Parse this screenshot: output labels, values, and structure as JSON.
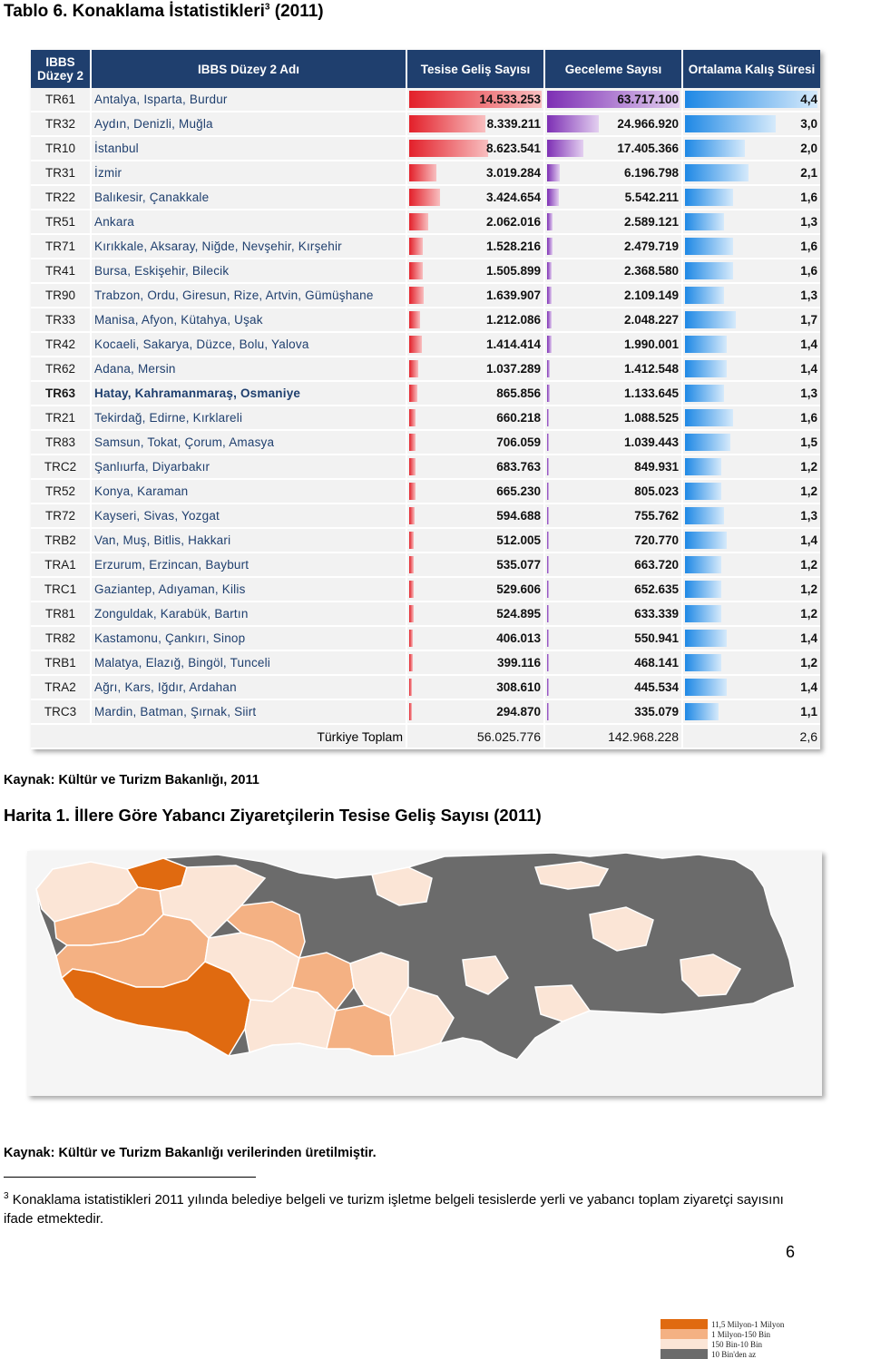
{
  "title": {
    "text": "Tablo 6. Konaklama İstatistikleri",
    "sup": "3",
    "tail": " (2011)"
  },
  "table": {
    "headers": [
      "IBBS Düzey 2",
      "IBBS Düzey 2 Adı",
      "Tesise Geliş Sayısı",
      "Geceleme Sayısı",
      "Ortalama Kalış Süresi"
    ],
    "rows": [
      {
        "code": "TR61",
        "name": "Antalya, Isparta, Burdur",
        "arrivals": "14.533.253",
        "nights": "63.717.100",
        "stay": "4,4",
        "a": 14533253,
        "n": 63717100,
        "s": 4.4
      },
      {
        "code": "TR32",
        "name": "Aydın, Denizli, Muğla",
        "arrivals": "8.339.211",
        "nights": "24.966.920",
        "stay": "3,0",
        "a": 8339211,
        "n": 24966920,
        "s": 3.0
      },
      {
        "code": "TR10",
        "name": "İstanbul",
        "arrivals": "8.623.541",
        "nights": "17.405.366",
        "stay": "2,0",
        "a": 8623541,
        "n": 17405366,
        "s": 2.0
      },
      {
        "code": "TR31",
        "name": "İzmir",
        "arrivals": "3.019.284",
        "nights": "6.196.798",
        "stay": "2,1",
        "a": 3019284,
        "n": 6196798,
        "s": 2.1
      },
      {
        "code": "TR22",
        "name": "Balıkesir, Çanakkale",
        "arrivals": "3.424.654",
        "nights": "5.542.211",
        "stay": "1,6",
        "a": 3424654,
        "n": 5542211,
        "s": 1.6
      },
      {
        "code": "TR51",
        "name": "Ankara",
        "arrivals": "2.062.016",
        "nights": "2.589.121",
        "stay": "1,3",
        "a": 2062016,
        "n": 2589121,
        "s": 1.3
      },
      {
        "code": "TR71",
        "name": "Kırıkkale, Aksaray, Niğde, Nevşehir, Kırşehir",
        "arrivals": "1.528.216",
        "nights": "2.479.719",
        "stay": "1,6",
        "a": 1528216,
        "n": 2479719,
        "s": 1.6
      },
      {
        "code": "TR41",
        "name": "Bursa, Eskişehir, Bilecik",
        "arrivals": "1.505.899",
        "nights": "2.368.580",
        "stay": "1,6",
        "a": 1505899,
        "n": 2368580,
        "s": 1.6
      },
      {
        "code": "TR90",
        "name": "Trabzon, Ordu, Giresun, Rize, Artvin, Gümüşhane",
        "arrivals": "1.639.907",
        "nights": "2.109.149",
        "stay": "1,3",
        "a": 1639907,
        "n": 2109149,
        "s": 1.3
      },
      {
        "code": "TR33",
        "name": "Manisa, Afyon, Kütahya, Uşak",
        "arrivals": "1.212.086",
        "nights": "2.048.227",
        "stay": "1,7",
        "a": 1212086,
        "n": 2048227,
        "s": 1.7
      },
      {
        "code": "TR42",
        "name": "Kocaeli, Sakarya, Düzce, Bolu, Yalova",
        "arrivals": "1.414.414",
        "nights": "1.990.001",
        "stay": "1,4",
        "a": 1414414,
        "n": 1990001,
        "s": 1.4
      },
      {
        "code": "TR62",
        "name": "Adana, Mersin",
        "arrivals": "1.037.289",
        "nights": "1.412.548",
        "stay": "1,4",
        "a": 1037289,
        "n": 1412548,
        "s": 1.4
      },
      {
        "code": "TR63",
        "name": "Hatay, Kahramanmaraş, Osmaniye",
        "arrivals": "865.856",
        "nights": "1.133.645",
        "stay": "1,3",
        "a": 865856,
        "n": 1133645,
        "s": 1.3,
        "bold": true
      },
      {
        "code": "TR21",
        "name": "Tekirdağ, Edirne, Kırklareli",
        "arrivals": "660.218",
        "nights": "1.088.525",
        "stay": "1,6",
        "a": 660218,
        "n": 1088525,
        "s": 1.6
      },
      {
        "code": "TR83",
        "name": "Samsun, Tokat, Çorum, Amasya",
        "arrivals": "706.059",
        "nights": "1.039.443",
        "stay": "1,5",
        "a": 706059,
        "n": 1039443,
        "s": 1.5
      },
      {
        "code": "TRC2",
        "name": "Şanlıurfa, Diyarbakır",
        "arrivals": "683.763",
        "nights": "849.931",
        "stay": "1,2",
        "a": 683763,
        "n": 849931,
        "s": 1.2
      },
      {
        "code": "TR52",
        "name": "Konya, Karaman",
        "arrivals": "665.230",
        "nights": "805.023",
        "stay": "1,2",
        "a": 665230,
        "n": 805023,
        "s": 1.2
      },
      {
        "code": "TR72",
        "name": "Kayseri, Sivas, Yozgat",
        "arrivals": "594.688",
        "nights": "755.762",
        "stay": "1,3",
        "a": 594688,
        "n": 755762,
        "s": 1.3
      },
      {
        "code": "TRB2",
        "name": "Van, Muş, Bitlis, Hakkari",
        "arrivals": "512.005",
        "nights": "720.770",
        "stay": "1,4",
        "a": 512005,
        "n": 720770,
        "s": 1.4
      },
      {
        "code": "TRA1",
        "name": "Erzurum, Erzincan, Bayburt",
        "arrivals": "535.077",
        "nights": "663.720",
        "stay": "1,2",
        "a": 535077,
        "n": 663720,
        "s": 1.2
      },
      {
        "code": "TRC1",
        "name": "Gaziantep, Adıyaman, Kilis",
        "arrivals": "529.606",
        "nights": "652.635",
        "stay": "1,2",
        "a": 529606,
        "n": 652635,
        "s": 1.2
      },
      {
        "code": "TR81",
        "name": "Zonguldak, Karabük, Bartın",
        "arrivals": "524.895",
        "nights": "633.339",
        "stay": "1,2",
        "a": 524895,
        "n": 633339,
        "s": 1.2
      },
      {
        "code": "TR82",
        "name": "Kastamonu, Çankırı, Sinop",
        "arrivals": "406.013",
        "nights": "550.941",
        "stay": "1,4",
        "a": 406013,
        "n": 550941,
        "s": 1.4
      },
      {
        "code": "TRB1",
        "name": "Malatya, Elazığ, Bingöl, Tunceli",
        "arrivals": "399.116",
        "nights": "468.141",
        "stay": "1,2",
        "a": 399116,
        "n": 468141,
        "s": 1.2
      },
      {
        "code": "TRA2",
        "name": "Ağrı, Kars, Iğdır, Ardahan",
        "arrivals": "308.610",
        "nights": "445.534",
        "stay": "1,4",
        "a": 308610,
        "n": 445534,
        "s": 1.4
      },
      {
        "code": "TRC3",
        "name": "Mardin, Batman, Şırnak, Siirt",
        "arrivals": "294.870",
        "nights": "335.079",
        "stay": "1,1",
        "a": 294870,
        "n": 335079,
        "s": 1.1
      }
    ],
    "total": {
      "label": "Türkiye Toplam",
      "arrivals": "56.025.776",
      "nights": "142.968.228",
      "stay": "2,6"
    }
  },
  "source1": "Kaynak: Kültür ve Turizm Bakanlığı, 2011",
  "map": {
    "title": "Harita 1. İllere Göre Yabancı Ziyaretçilerin Tesise Geliş Sayısı (2011)",
    "legend": [
      {
        "label": "11,5 Milyon-1 Milyon",
        "color": "#e06a10"
      },
      {
        "label": "1 Milyon-150 Bin",
        "color": "#f4b183"
      },
      {
        "label": "150 Bin-10 Bin",
        "color": "#fbe5d6"
      },
      {
        "label": "10 Bin'den az",
        "color": "#6b6b6b"
      }
    ]
  },
  "source2": "Kaynak: Kültür ve Turizm Bakanlığı verilerinden üretilmiştir.",
  "footnote": {
    "num": "3",
    "text": " Konaklama istatistikleri 2011 yılında belediye belgeli ve turizm işletme belgeli tesislerde yerli ve yabancı toplam ziyaretçi sayısını ifade etmektedir."
  },
  "page_number": "6"
}
